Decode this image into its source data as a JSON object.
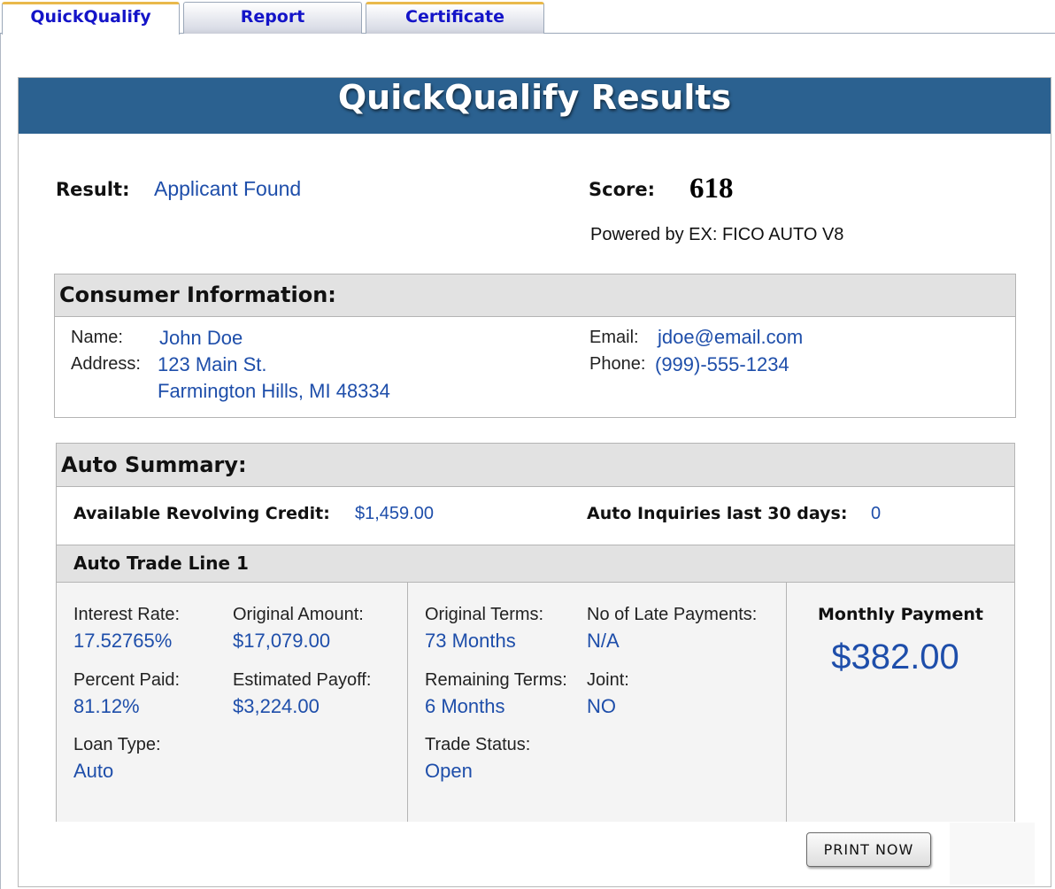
{
  "tabs": [
    {
      "label": "QuickQualify",
      "active": true
    },
    {
      "label": "Report",
      "active": false
    },
    {
      "label": "Certificate",
      "active": false
    }
  ],
  "header": {
    "title": "QuickQualify Results"
  },
  "result": {
    "label": "Result:",
    "value": "Applicant Found"
  },
  "score": {
    "label": "Score:",
    "value": "618",
    "powered_by": "Powered by EX: FICO AUTO V8"
  },
  "consumer": {
    "heading": "Consumer Information:",
    "name_label": "Name:",
    "name": "John Doe",
    "address_label": "Address:",
    "address_line1": "123 Main St.",
    "address_line2": "Farmington Hills, MI 48334",
    "email_label": "Email:",
    "email": "jdoe@email.com",
    "phone_label": "Phone:",
    "phone": "(999)-555-1234"
  },
  "auto_summary": {
    "heading": "Auto Summary:",
    "revolving_label": "Available Revolving Credit:",
    "revolving_value": "$1,459.00",
    "inquiries_label": "Auto Inquiries last 30 days:",
    "inquiries_value": "0"
  },
  "trade_line": {
    "heading": "Auto Trade Line 1",
    "interest_rate_label": "Interest Rate:",
    "interest_rate": "17.52765%",
    "original_amount_label": "Original Amount:",
    "original_amount": "$17,079.00",
    "percent_paid_label": "Percent Paid:",
    "percent_paid": "81.12%",
    "estimated_payoff_label": "Estimated Payoff:",
    "estimated_payoff": "$3,224.00",
    "loan_type_label": "Loan Type:",
    "loan_type": "Auto",
    "original_terms_label": "Original Terms:",
    "original_terms": "73 Months",
    "late_payments_label": "No of Late Payments:",
    "late_payments": "N/A",
    "remaining_terms_label": "Remaining Terms:",
    "remaining_terms": "6 Months",
    "joint_label": "Joint:",
    "joint": "NO",
    "trade_status_label": "Trade Status:",
    "trade_status": "Open",
    "monthly_payment_label": "Monthly Payment",
    "monthly_payment": "$382.00"
  },
  "actions": {
    "print_label": "PRINT NOW"
  },
  "colors": {
    "banner": "#2b6190",
    "value_blue": "#1e4eaa",
    "tab_text": "#1414c8",
    "tab_accent": "#e9b94b"
  }
}
